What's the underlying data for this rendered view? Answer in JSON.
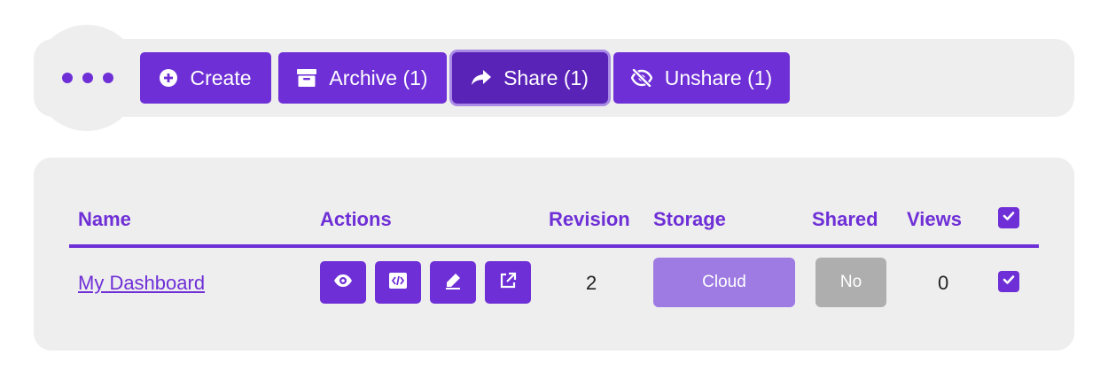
{
  "toolbar": {
    "more_icon": "more-dots-icon",
    "buttons": [
      {
        "label": "Create",
        "icon": "plus-circle-icon"
      },
      {
        "label": "Archive (1)",
        "icon": "archive-box-icon"
      },
      {
        "label": "Share (1)",
        "icon": "share-arrow-icon"
      },
      {
        "label": "Unshare (1)",
        "icon": "eye-slash-icon"
      }
    ]
  },
  "table": {
    "headers": {
      "name": "Name",
      "actions": "Actions",
      "revision": "Revision",
      "storage": "Storage",
      "shared": "Shared",
      "views": "Views",
      "select_all_checked": true
    },
    "rows": [
      {
        "name": "My Dashboard",
        "actions": [
          "eye-icon",
          "code-icon",
          "pencil-icon",
          "external-link-icon"
        ],
        "revision": "2",
        "storage": "Cloud",
        "shared": "No",
        "views": "0",
        "checked": true
      }
    ]
  },
  "colors": {
    "accent": "#6e2fd6",
    "accent_active": "#5a23b8",
    "storage_pill": "#9d7be3",
    "shared_pill": "#aeaeae",
    "panel_bg": "#efeeef"
  }
}
